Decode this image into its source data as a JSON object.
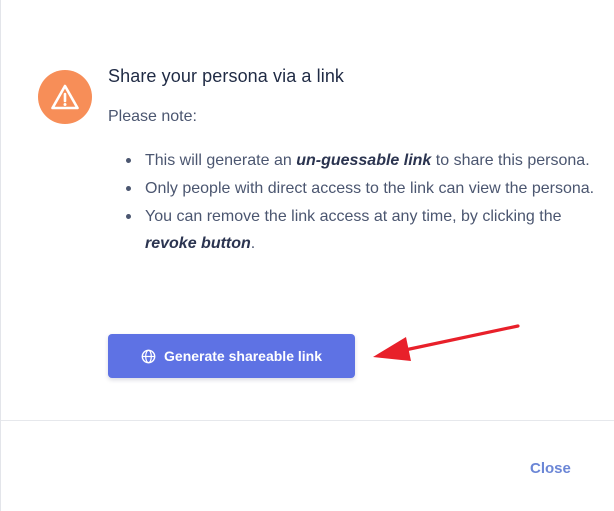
{
  "dialog": {
    "title": "Share your persona via a link",
    "note": "Please note:",
    "points": [
      {
        "pre": "This will generate an ",
        "bold": "un-guessable link",
        "post": " to share this persona."
      },
      {
        "pre": "Only people with direct access to the link can view the persona.",
        "bold": "",
        "post": ""
      },
      {
        "pre": "You can remove the link access at any time, by clicking the ",
        "bold": "revoke button",
        "post": "."
      }
    ],
    "generate_button_label": "Generate shareable link",
    "close_label": "Close"
  },
  "icons": {
    "warning": "warning-triangle-icon",
    "globe": "globe-icon",
    "annotation_arrow": "red-arrow-icon"
  },
  "colors": {
    "warning_bg": "#f78e58",
    "primary": "#5e72e4",
    "link": "#6b86d6",
    "annotation": "#e8202a"
  }
}
